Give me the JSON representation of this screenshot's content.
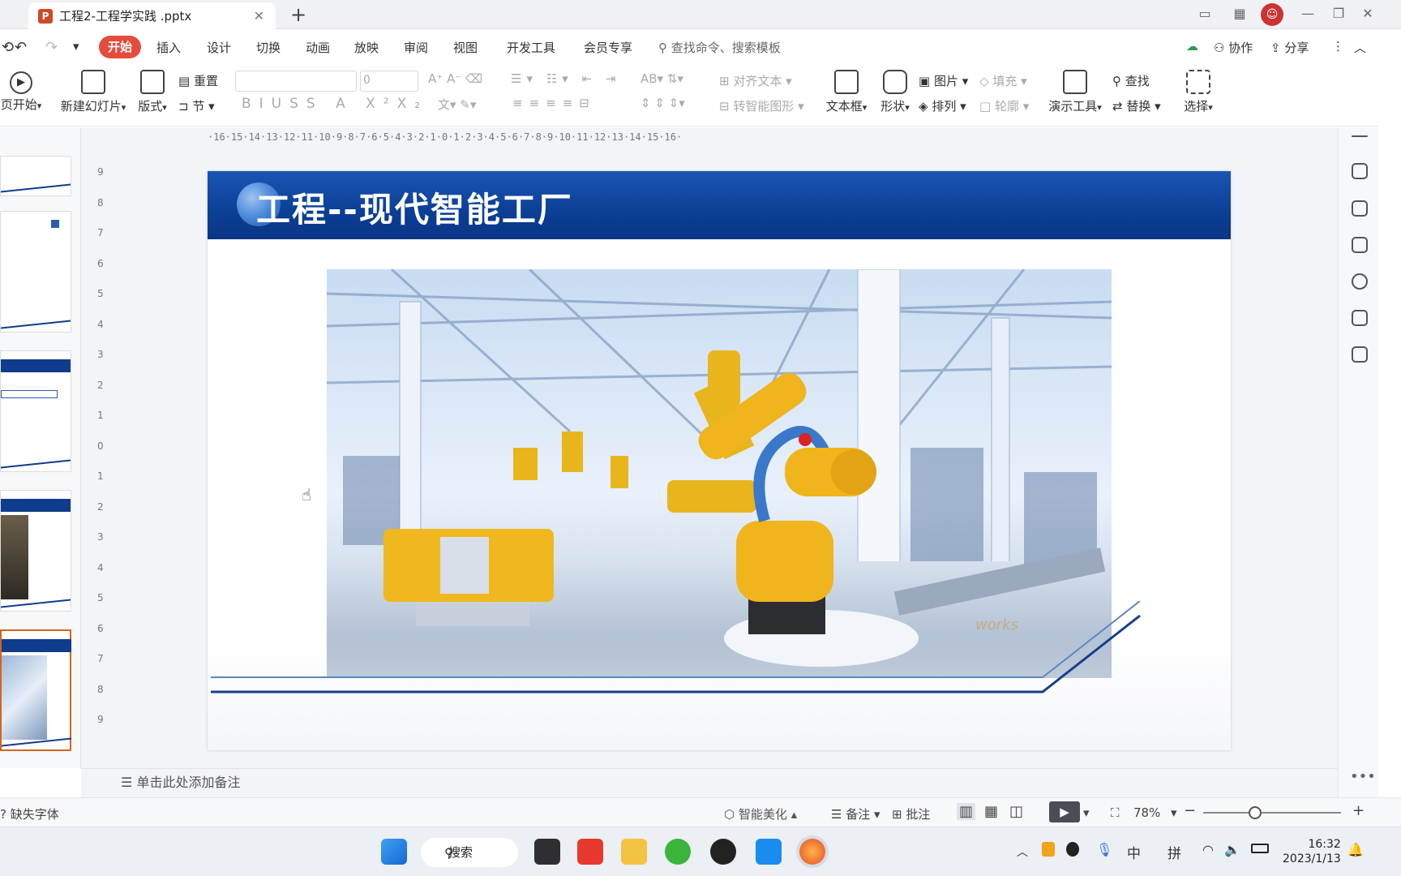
{
  "window": {
    "tab_title": "工程2-工程学实践 .pptx",
    "app_icon": "P"
  },
  "menu": {
    "items": [
      "开始",
      "插入",
      "设计",
      "切换",
      "动画",
      "放映",
      "审阅",
      "视图",
      "开发工具",
      "会员专享"
    ],
    "search_placeholder": "查找命令、搜索模板",
    "collab": "协作",
    "share": "分享"
  },
  "ribbon": {
    "from_page": "页开始",
    "new_slide": "新建幻灯片",
    "layout": "版式",
    "reset": "重置",
    "section": "节",
    "font_size_value": "0",
    "align_text": "对齐文本",
    "convert_smartart": "转智能图形",
    "textbox": "文本框",
    "shape": "形状",
    "picture": "图片",
    "arrange": "排列",
    "fill": "填充",
    "outline": "轮廓",
    "presenter_tools": "演示工具",
    "find": "查找",
    "replace": "替换",
    "select": "选择"
  },
  "ruler": {
    "horizontal": "·16·15·14·13·12·11·10·9·8·7·6·5·4·3·2·1·0·1·2·3·4·5·6·7·8·9·10·11·12·13·14·15·16·",
    "vertical": [
      "9",
      "8",
      "7",
      "6",
      "5",
      "4",
      "3",
      "2",
      "1",
      "0",
      "1",
      "2",
      "3",
      "4",
      "5",
      "6",
      "7",
      "8",
      "9"
    ]
  },
  "slide": {
    "title": "工程--现代智能工厂",
    "watermark": "works"
  },
  "notes": {
    "placeholder": "单击此处添加备注"
  },
  "statusbar": {
    "missing_font": "缺失字体",
    "smart_beautify": "智能美化",
    "notes": "备注",
    "comments": "批注",
    "zoom": "78%"
  },
  "taskbar": {
    "search": "搜索",
    "ime_lang": "中",
    "ime_mode": "拼",
    "time": "16:32",
    "date": "2023/1/13"
  },
  "colors": {
    "accent_red": "#e64b3c",
    "slide_blue": "#0f3c8c",
    "ppt_orange": "#d24726"
  }
}
